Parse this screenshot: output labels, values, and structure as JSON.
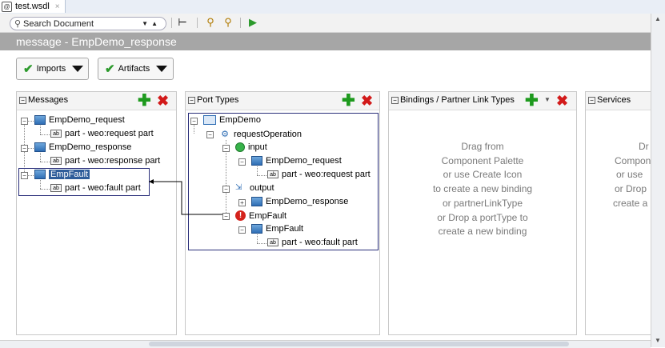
{
  "tab": {
    "title": "test.wsdl",
    "close": "×"
  },
  "toolbar": {
    "search_placeholder": "Search Document"
  },
  "header": {
    "title": "message - EmpDemo_response"
  },
  "drop_buttons": {
    "imports": "Imports",
    "artifacts": "Artifacts"
  },
  "panels": {
    "messages": {
      "title": "Messages",
      "items": [
        {
          "name": "EmpDemo_request",
          "part": "part - weo:request part"
        },
        {
          "name": "EmpDemo_response",
          "part": "part - weo:response part"
        },
        {
          "name": "EmpFault",
          "part": "part - weo:fault part"
        }
      ]
    },
    "port_types": {
      "title": "Port Types",
      "port_type": "EmpDemo",
      "operation": "requestOperation",
      "input": "input",
      "input_message": "EmpDemo_request",
      "input_part": "part - weo:request part",
      "output": "output",
      "output_message": "EmpDemo_response",
      "fault": "EmpFault",
      "fault_message": "EmpFault",
      "fault_part": "part - weo:fault part"
    },
    "bindings": {
      "title": "Bindings / Partner Link Types",
      "hint": [
        "Drag from",
        "Component Palette",
        "or use Create Icon",
        "to create a new binding",
        "or partnerLinkType",
        "or Drop a portType to",
        "create a new binding"
      ]
    },
    "services": {
      "title": "Services",
      "hint": [
        "Dr",
        "Compon",
        "or use",
        "or Drop",
        "create a"
      ]
    }
  },
  "colors": {
    "header_band": "#a6a6a6",
    "selection": "#2e5d9a",
    "add": "#1e9a1e",
    "delete": "#d21a1a"
  }
}
